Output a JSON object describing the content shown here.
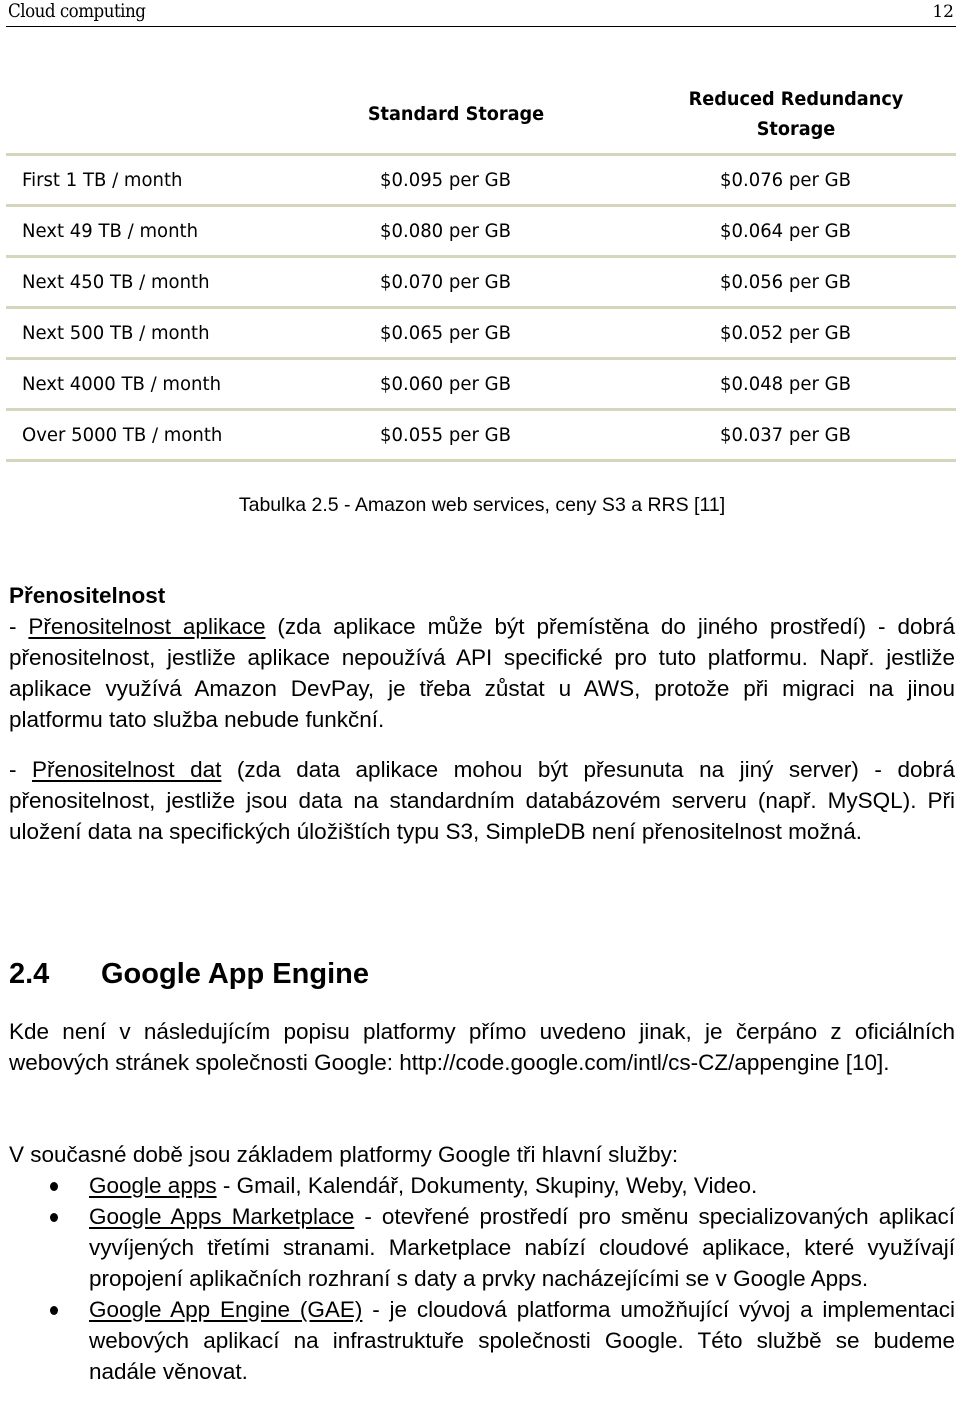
{
  "header": {
    "title": "Cloud computing",
    "page_number": "12"
  },
  "pricing_table": {
    "columns": [
      "",
      "Standard Storage",
      "Reduced Redundancy Storage"
    ],
    "col_standard_label": "Standard Storage",
    "col_rrs_label_line1": "Reduced Redundancy",
    "col_rrs_label_line2": "Storage",
    "rows": [
      {
        "tier": "First 1 TB / month",
        "standard": "$0.095 per GB",
        "rrs": "$0.076 per GB"
      },
      {
        "tier": "Next 49 TB / month",
        "standard": "$0.080 per GB",
        "rrs": "$0.064 per GB"
      },
      {
        "tier": "Next 450 TB / month",
        "standard": "$0.070 per GB",
        "rrs": "$0.056 per GB"
      },
      {
        "tier": "Next 500 TB / month",
        "standard": "$0.065 per GB",
        "rrs": "$0.052 per GB"
      },
      {
        "tier": "Next 4000 TB / month",
        "standard": "$0.060 per GB",
        "rrs": "$0.048 per GB"
      },
      {
        "tier": "Over 5000 TB / month",
        "standard": "$0.055 per GB",
        "rrs": "$0.037 per GB"
      }
    ],
    "caption": "Tabulka 2.5 - Amazon web services, ceny S3 a RRS [11]",
    "rule_color": "#d6d6bc"
  },
  "portability": {
    "heading": "Přenositelnost",
    "app_dash": "- ",
    "app_term": "Přenositelnost aplikace",
    "app_text": " (zda aplikace může být přemístěna do jiného prostředí) - dobrá přenositelnost, jestliže aplikace nepoužívá API specifické pro tuto platformu. Např. jestliže aplikace využívá Amazon DevPay, je třeba zůstat u AWS, protože při migraci na jinou platformu tato služba nebude funkční.",
    "data_dash": "- ",
    "data_term": "Přenositelnost dat",
    "data_text": " (zda data aplikace mohou být přesunuta na jiný server) - dobrá přenositelnost, jestliže jsou data na standardním databázovém serveru (např. MySQL). Při uložení data na specifických úložištích typu S3, SimpleDB není přenositelnost možná."
  },
  "section": {
    "number": "2.4",
    "title": "Google App Engine",
    "intro": "Kde není v následujícím popisu platformy přímo uvedeno jinak, je čerpáno z oficiálních webových stránek společnosti Google: http://code.google.com/intl/cs-CZ/appengine [10].",
    "services_lead": "V současné době jsou základem platformy Google tři hlavní služby:",
    "services": [
      {
        "term": "Google apps",
        "text": " - Gmail, Kalendář, Dokumenty, Skupiny, Weby, Video."
      },
      {
        "term": "Google Apps Marketplace",
        "text": " - otevřené prostředí pro směnu specializovaných aplikací vyvíjených třetími stranami. Marketplace nabízí cloudové aplikace, které využívají propojení aplikačních rozhraní s daty a prvky nacházejícími se v Google Apps."
      },
      {
        "term": "Google App Engine (GAE)",
        "text": " - je cloudová platforma umožňující vývoj a implementaci webových aplikací na infrastruktuře společnosti Google. Této službě se budeme nadále věnovat."
      }
    ]
  }
}
